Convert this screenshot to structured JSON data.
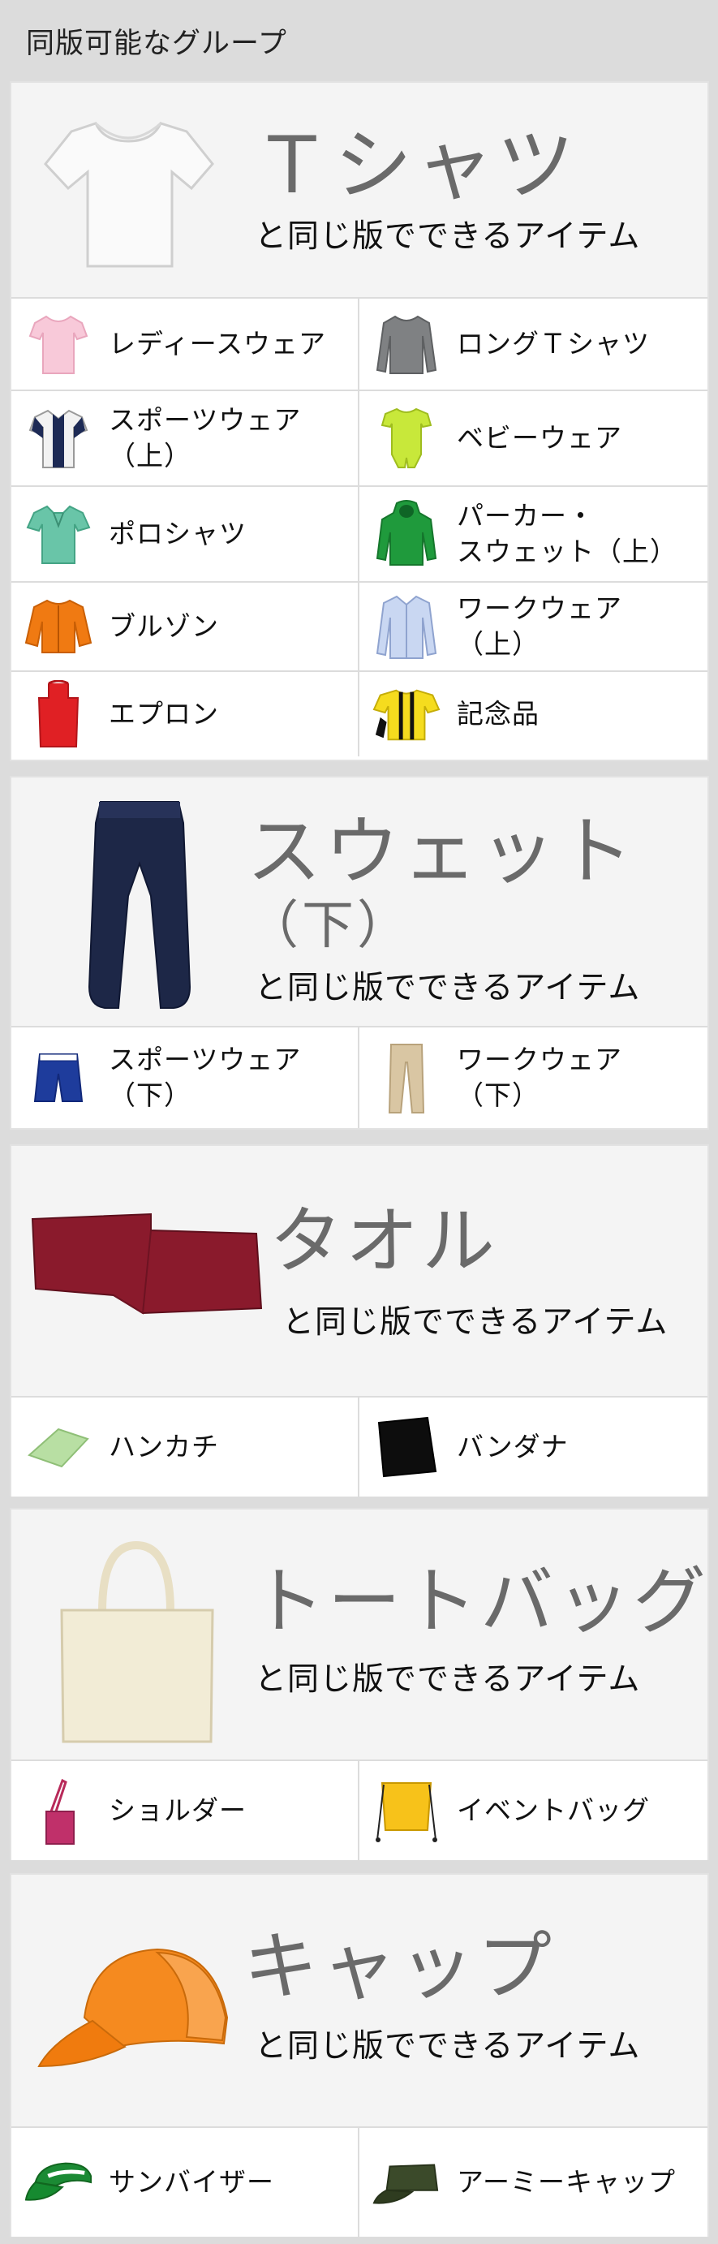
{
  "header": {
    "title": "同版可能なグループ"
  },
  "groups": [
    {
      "title": "Ｔシャツ",
      "subtitle": "と同じ版でできるアイテム",
      "items": [
        {
          "label": "レディースウェア",
          "icon": "ladies-tshirt-icon"
        },
        {
          "label": "ロングＴシャツ",
          "icon": "long-tshirt-icon"
        },
        {
          "label": "スポーツウェア\n（上）",
          "icon": "sports-shirt-icon"
        },
        {
          "label": "ベビーウェア",
          "icon": "baby-romper-icon"
        },
        {
          "label": "ポロシャツ",
          "icon": "polo-shirt-icon"
        },
        {
          "label": "パーカー・\nスウェット（上）",
          "icon": "hoodie-icon"
        },
        {
          "label": "ブルゾン",
          "icon": "blouson-icon"
        },
        {
          "label": "ワークウェア\n（上）",
          "icon": "work-shirt-icon"
        },
        {
          "label": "エプロン",
          "icon": "apron-icon"
        },
        {
          "label": "記念品",
          "icon": "souvenir-icon"
        }
      ]
    },
    {
      "title": "スウェット",
      "title2": "（下）",
      "subtitle": "と同じ版でできるアイテム",
      "items": [
        {
          "label": "スポーツウェア\n（下）",
          "icon": "sports-shorts-icon"
        },
        {
          "label": "ワークウェア\n（下）",
          "icon": "work-pants-icon"
        }
      ]
    },
    {
      "title": "タオル",
      "subtitle": "と同じ版でできるアイテム",
      "items": [
        {
          "label": "ハンカチ",
          "icon": "handkerchief-icon"
        },
        {
          "label": "バンダナ",
          "icon": "bandana-icon"
        }
      ]
    },
    {
      "title": "トートバッグ",
      "subtitle": "と同じ版でできるアイテム",
      "items": [
        {
          "label": "ショルダー",
          "icon": "shoulder-bag-icon"
        },
        {
          "label": "イベントバッグ",
          "icon": "drawstring-bag-icon"
        }
      ]
    },
    {
      "title": "キャップ",
      "subtitle": "と同じ版でできるアイテム",
      "items": [
        {
          "label": "サンバイザー",
          "icon": "sun-visor-icon"
        },
        {
          "label": "アーミーキャップ",
          "icon": "army-cap-icon"
        }
      ]
    }
  ]
}
